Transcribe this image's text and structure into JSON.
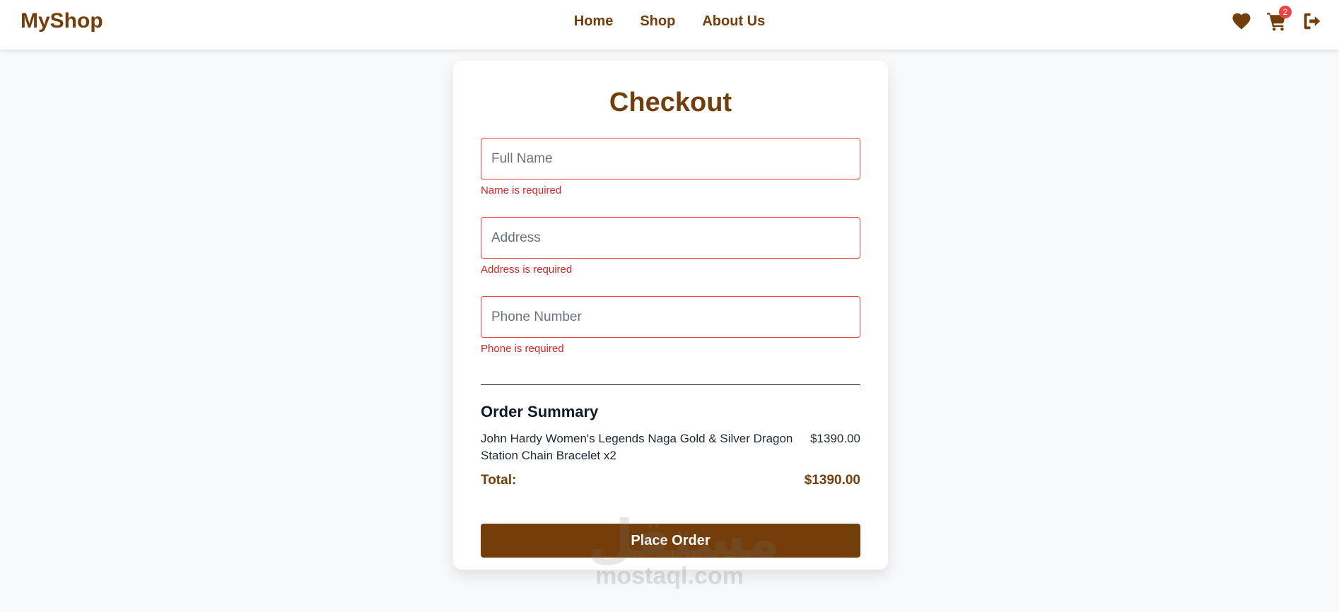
{
  "navbar": {
    "brand": "MyShop",
    "links": [
      "Home",
      "Shop",
      "About Us"
    ],
    "icons": [
      "heart-icon",
      "cart-icon",
      "logout-icon"
    ],
    "cart_count": "2"
  },
  "checkout": {
    "title": "Checkout",
    "fields": [
      {
        "placeholder": "Full Name",
        "value": "",
        "error": "Name is required"
      },
      {
        "placeholder": "Address",
        "value": "",
        "error": "Address is required"
      },
      {
        "placeholder": "Phone Number",
        "value": "",
        "error": "Phone is required"
      }
    ],
    "summary": {
      "title": "Order Summary",
      "items": [
        {
          "name": "John Hardy Women's Legends Naga Gold & Silver Dragon Station Chain Bracelet x2",
          "price": "$1390.00"
        }
      ],
      "total_label": "Total:",
      "total_value": "$1390.00"
    },
    "place_order_label": "Place Order"
  },
  "watermark": {
    "arabic": "مستقل",
    "latin": "mostaql.com"
  },
  "colors": {
    "brand": "#733e0a",
    "error": "#ef4444",
    "background": "#f8f9fb"
  }
}
